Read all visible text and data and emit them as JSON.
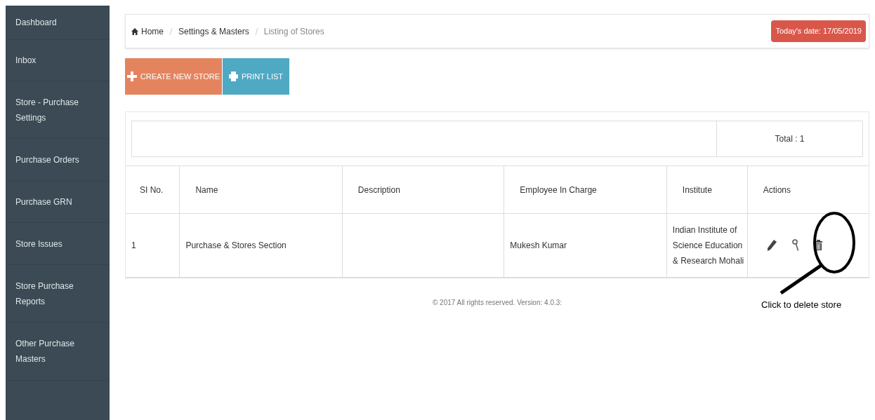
{
  "sidebar": {
    "items": [
      {
        "label": "Dashboard",
        "selected": false
      },
      {
        "label": "Inbox",
        "selected": false
      },
      {
        "label": "Store - Purchase Settings",
        "selected": false
      },
      {
        "label": "Purchase Orders",
        "selected": false
      },
      {
        "label": "Purchase GRN",
        "selected": false
      },
      {
        "label": "Store Issues",
        "selected": false
      },
      {
        "label": "Store Purchase Reports",
        "selected": false
      },
      {
        "label": "Other Purchase Masters",
        "selected": false
      }
    ]
  },
  "breadcrumb": [
    "Home",
    "Settings & Masters",
    "Listing of Stores"
  ],
  "date_badge": "Today's date: 17/05/2019",
  "buttons": [
    {
      "kind": "create",
      "label": "CREATE NEW STORE"
    },
    {
      "kind": "print",
      "label": "PRINT LIST"
    }
  ],
  "total": "Total : 1",
  "table": {
    "columns": [
      "SI No.",
      "Name",
      "Description",
      "Employee In Charge",
      "Institute",
      "Actions"
    ],
    "rows": [
      {
        "cells": [
          "1",
          "Purchase & Stores Section",
          "",
          "Mukesh Kumar",
          "Indian Institute of Science Education & Research Mohali"
        ]
      }
    ]
  },
  "footer": "© 2017  All rights reserved. Version: 4.0.3:",
  "annotation": "Click to delete store"
}
